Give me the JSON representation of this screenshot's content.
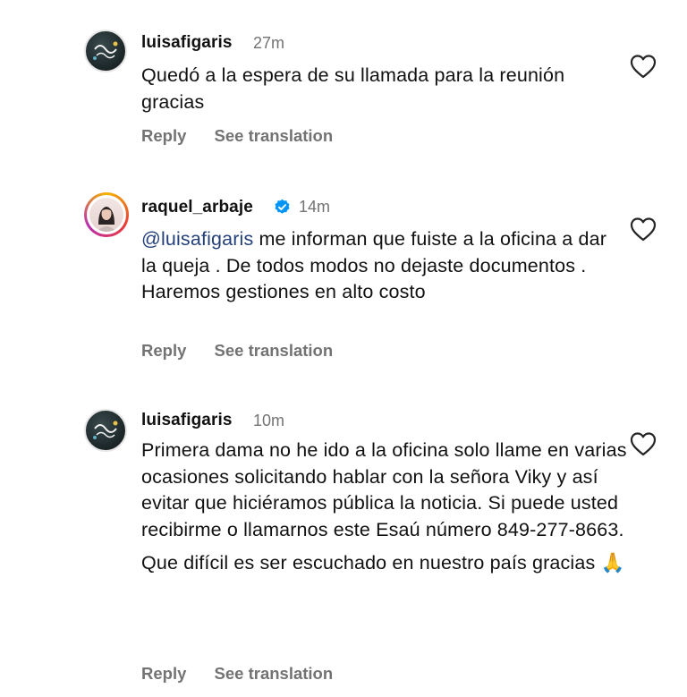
{
  "comments": [
    {
      "username": "luisafigaris",
      "time": "27m",
      "verified": false,
      "paragraphs": [
        "Quedó a la espera de su llamada para la reunión gracias"
      ],
      "reply": "Reply",
      "translate": "See translation"
    },
    {
      "username": "raquel_arbaje",
      "time": "14m",
      "verified": true,
      "mention": "@luisafigaris",
      "paragraphs": [
        " me informan que fuiste a la oficina a dar la queja . De todos modos no dejaste documentos . Haremos gestiones en alto costo"
      ],
      "reply": "Reply",
      "translate": "See translation"
    },
    {
      "username": "luisafigaris",
      "time": "10m",
      "verified": false,
      "paragraphs": [
        "Primera dama no he ido a la oficina solo llame en varias ocasiones solicitando hablar con la señora Viky y así evitar que hiciéramos pública la noticia. Si puede usted recibirme o llamarnos este Esaú número 849-277-8663.",
        "Que difícil es ser escuchado en nuestro país gracias 🙏"
      ],
      "reply": "Reply",
      "translate": "See translation"
    }
  ],
  "colors": {
    "text": "#111111",
    "secondary": "#737373",
    "mention": "#24407a",
    "verified": "#0095f6"
  }
}
